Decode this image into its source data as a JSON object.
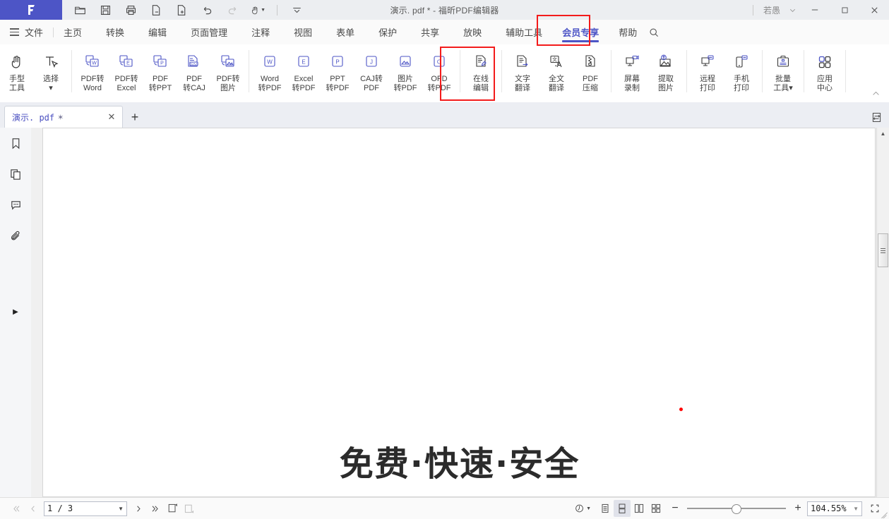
{
  "titlebar": {
    "document_title": "演示. pdf * - 福昕PDF编辑器",
    "user_name": "若愚",
    "quick_access": [
      {
        "name": "open-icon",
        "label": "打开"
      },
      {
        "name": "save-icon",
        "label": "保存"
      },
      {
        "name": "print-icon",
        "label": "打印"
      },
      {
        "name": "export-icon",
        "label": "导出"
      },
      {
        "name": "new-page-icon",
        "label": "新建"
      },
      {
        "name": "undo-icon",
        "label": "撤销"
      },
      {
        "name": "redo-icon",
        "label": "恢复"
      },
      {
        "name": "hand-tool-icon",
        "label": "手型工具"
      },
      {
        "name": "customize-qat-icon",
        "label": "自定义"
      }
    ],
    "window_controls": {
      "minimize": "—",
      "maximize": "▢",
      "close": "✕"
    }
  },
  "menubar": {
    "items": [
      {
        "label": "文件",
        "active": false
      },
      {
        "label": "主页",
        "active": false
      },
      {
        "label": "转换",
        "active": false
      },
      {
        "label": "编辑",
        "active": false
      },
      {
        "label": "页面管理",
        "active": false
      },
      {
        "label": "注释",
        "active": false
      },
      {
        "label": "视图",
        "active": false
      },
      {
        "label": "表单",
        "active": false
      },
      {
        "label": "保护",
        "active": false
      },
      {
        "label": "共享",
        "active": false
      },
      {
        "label": "放映",
        "active": false
      },
      {
        "label": "辅助工具",
        "active": false
      },
      {
        "label": "会员专享",
        "active": true
      },
      {
        "label": "帮助",
        "active": false
      }
    ],
    "active_tab": "会员专享",
    "active_color": "#4d55c6",
    "highlight_color": "#f31b1b"
  },
  "ribbon": {
    "groups": [
      {
        "name": "tools",
        "items": [
          {
            "name": "hand-tool",
            "label": "手型\n工具",
            "icon": "hand"
          },
          {
            "name": "select-tool",
            "label": "选择\n▾",
            "icon": "select"
          }
        ]
      },
      {
        "name": "pdf-to-x",
        "items": [
          {
            "name": "pdf-to-word",
            "label": "PDF转\nWord",
            "icon": "conv-w"
          },
          {
            "name": "pdf-to-excel",
            "label": "PDF转\nExcel",
            "icon": "conv-e"
          },
          {
            "name": "pdf-to-ppt",
            "label": "PDF\n转PPT",
            "icon": "conv-p"
          },
          {
            "name": "pdf-to-caj",
            "label": "PDF\n转CAJ",
            "icon": "conv-caj"
          },
          {
            "name": "pdf-to-image",
            "label": "PDF转\n图片",
            "icon": "conv-img"
          }
        ]
      },
      {
        "name": "x-to-pdf",
        "items": [
          {
            "name": "word-to-pdf",
            "label": "Word\n转PDF",
            "icon": "box-W"
          },
          {
            "name": "excel-to-pdf",
            "label": "Excel\n转PDF",
            "icon": "box-E"
          },
          {
            "name": "ppt-to-pdf",
            "label": "PPT\n转PDF",
            "icon": "box-P"
          },
          {
            "name": "caj-to-pdf",
            "label": "CAJ转\nPDF",
            "icon": "box-J"
          },
          {
            "name": "image-to-pdf",
            "label": "图片\n转PDF",
            "icon": "box-img"
          },
          {
            "name": "ofd-to-pdf",
            "label": "OFD\n转PDF",
            "icon": "box-O"
          }
        ]
      },
      {
        "name": "edit-online",
        "items": [
          {
            "name": "online-edit",
            "label": "在线\n编辑",
            "icon": "online"
          }
        ]
      },
      {
        "name": "translate",
        "highlighted": true,
        "items": [
          {
            "name": "text-translate",
            "label": "文字\n翻译",
            "icon": "text-trans"
          },
          {
            "name": "full-translate",
            "label": "全文\n翻译",
            "icon": "full-trans"
          }
        ]
      },
      {
        "name": "compress",
        "items": [
          {
            "name": "pdf-compress",
            "label": "PDF\n压缩",
            "icon": "compress"
          }
        ]
      },
      {
        "name": "capture",
        "items": [
          {
            "name": "screen-record",
            "label": "屏幕\n录制",
            "icon": "record"
          },
          {
            "name": "extract-image",
            "label": "提取\n图片",
            "icon": "extract"
          }
        ]
      },
      {
        "name": "print",
        "items": [
          {
            "name": "remote-print",
            "label": "远程\n打印",
            "icon": "remote-print"
          },
          {
            "name": "mobile-print",
            "label": "手机\n打印",
            "icon": "mobile-print"
          }
        ]
      },
      {
        "name": "batch",
        "items": [
          {
            "name": "batch-tools",
            "label": "批量\n工具▾",
            "icon": "toolbox"
          }
        ]
      },
      {
        "name": "apps",
        "items": [
          {
            "name": "app-center",
            "label": "应用\n中心",
            "icon": "grid"
          }
        ]
      }
    ]
  },
  "doctabs": {
    "tabs": [
      {
        "name": "演示. pdf",
        "dirty": "✶"
      }
    ],
    "close_label": "✕",
    "new_tab_label": "+"
  },
  "leftrail": {
    "items": [
      {
        "name": "bookmark-icon",
        "label": "书签"
      },
      {
        "name": "pages-icon",
        "label": "页面缩略图"
      },
      {
        "name": "comments-icon",
        "label": "注释"
      },
      {
        "name": "attachments-icon",
        "label": "附件"
      }
    ],
    "expand_label": "▶"
  },
  "document": {
    "heading": "免费·快速·安全",
    "page_background": "#ffffff"
  },
  "statusbar": {
    "first_page_label": "«",
    "prev_page_label": "‹",
    "page_value": "1 / 3",
    "next_page_label": "›",
    "last_page_label": "»",
    "fit_page_label": "适合页面",
    "fit_width_label": "适合宽度",
    "rotate_label": "旋转",
    "view_modes": [
      {
        "name": "single-page-view",
        "selected": false
      },
      {
        "name": "continuous-view",
        "selected": true
      },
      {
        "name": "two-page-view",
        "selected": false
      },
      {
        "name": "two-page-continuous-view",
        "selected": false
      }
    ],
    "zoom_out_label": "−",
    "zoom_in_label": "+",
    "zoom_value": "104.55%",
    "fullscreen_label": "全屏"
  }
}
